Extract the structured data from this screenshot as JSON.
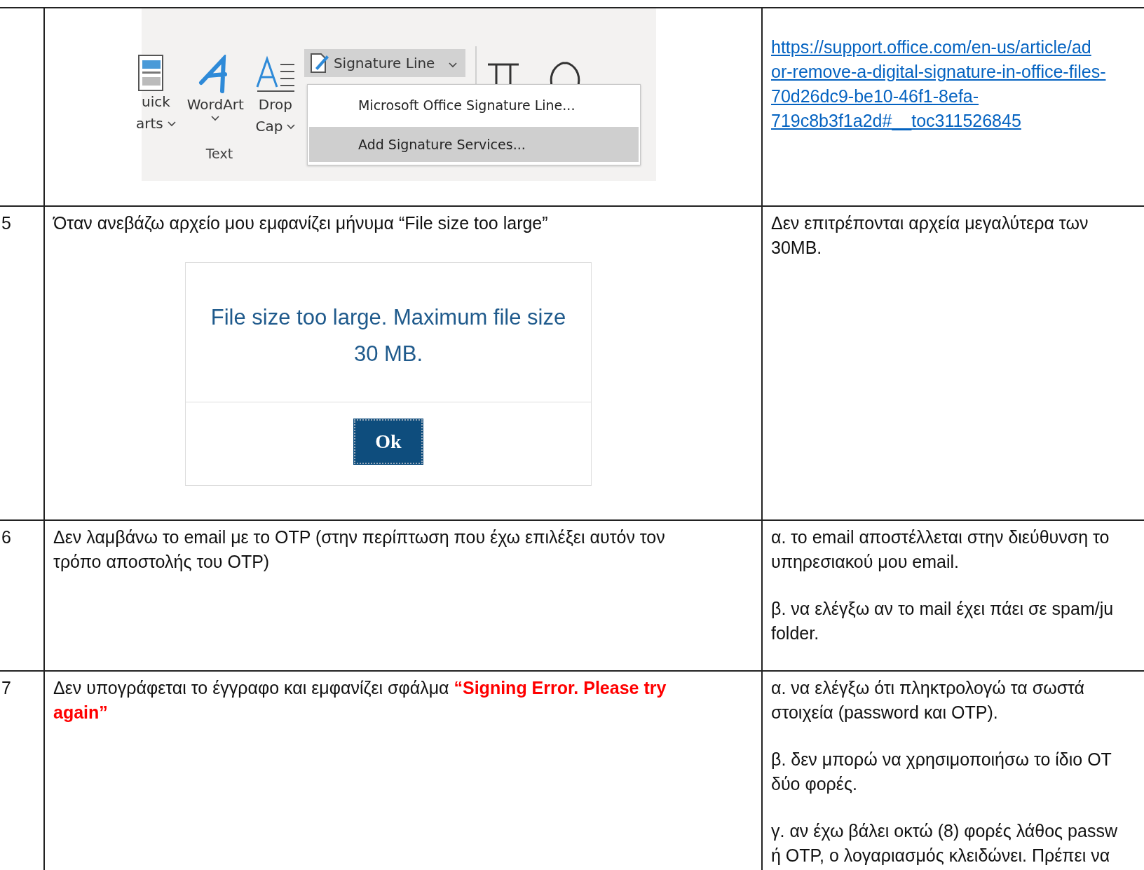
{
  "table": {
    "rows": [
      {
        "kind": "ribbon",
        "ribbon": {
          "text_group": {
            "label": "Text",
            "buttons": [
              {
                "kind": "quick_parts",
                "lines": [
                  "uick",
                  "arts"
                ],
                "dropdown": true
              },
              {
                "kind": "wordart",
                "lines": [
                  "WordArt"
                ],
                "dropdown": true
              },
              {
                "kind": "drop_cap",
                "lines": [
                  "Drop",
                  "Cap"
                ],
                "dropdown": true
              }
            ]
          },
          "signature_button": {
            "label": "Signature Line"
          },
          "menu": [
            {
              "label": "Microsoft Office Signature Line...",
              "selected": false
            },
            {
              "label": "Add Signature Services...",
              "selected": true
            }
          ]
        },
        "answer_link": "https://support.office.com/en-us/article/ad\nor-remove-a-digital-signature-in-office-files-\n70d26dc9-be10-46f1-8efa-\n719c8b3f1a2d#__toc311526845"
      },
      {
        "kind": "dialog",
        "number": "5",
        "question": "Όταν ανεβάζω αρχείο μου εμφανίζει μήνυμα “File size too large”",
        "dialog": {
          "message": "File size too large. Maximum file size\n30 MB.",
          "button": "Ok"
        },
        "answers": [
          "Δεν επιτρέπονται αρχεία μεγαλύτερα των\n30MB."
        ]
      },
      {
        "kind": "text",
        "number": "6",
        "question": "Δεν λαμβάνω το email με το OTP (στην περίπτωση που έχω επιλέξει αυτόν τον\nτρόπο αποστολής του OTP)",
        "answers": [
          "α. το email αποστέλλεται στην διεύθυνση το\nυπηρεσιακού μου email.",
          "β. να ελέγξω αν το mail έχει πάει σε spam/ju\nfolder."
        ]
      },
      {
        "kind": "text",
        "number": "7",
        "question": "Δεν υπογράφεται το έγγραφο και εμφανίζει σφάλμα **“Signing Error. Please try**\n**again”**",
        "answers": [
          "α. να ελέγξω ότι πληκτρολογώ τα σωστά\nστοιχεία (password και OTP).",
          "β. δεν μπορώ να χρησιμοποιήσω το ίδιο OT\nδύο φορές.",
          "γ. αν έχω βάλει οκτώ (8) φορές λάθος passw\nή OTP, ο λογαριασμός κλειδώνει. Πρέπει να"
        ]
      }
    ]
  }
}
